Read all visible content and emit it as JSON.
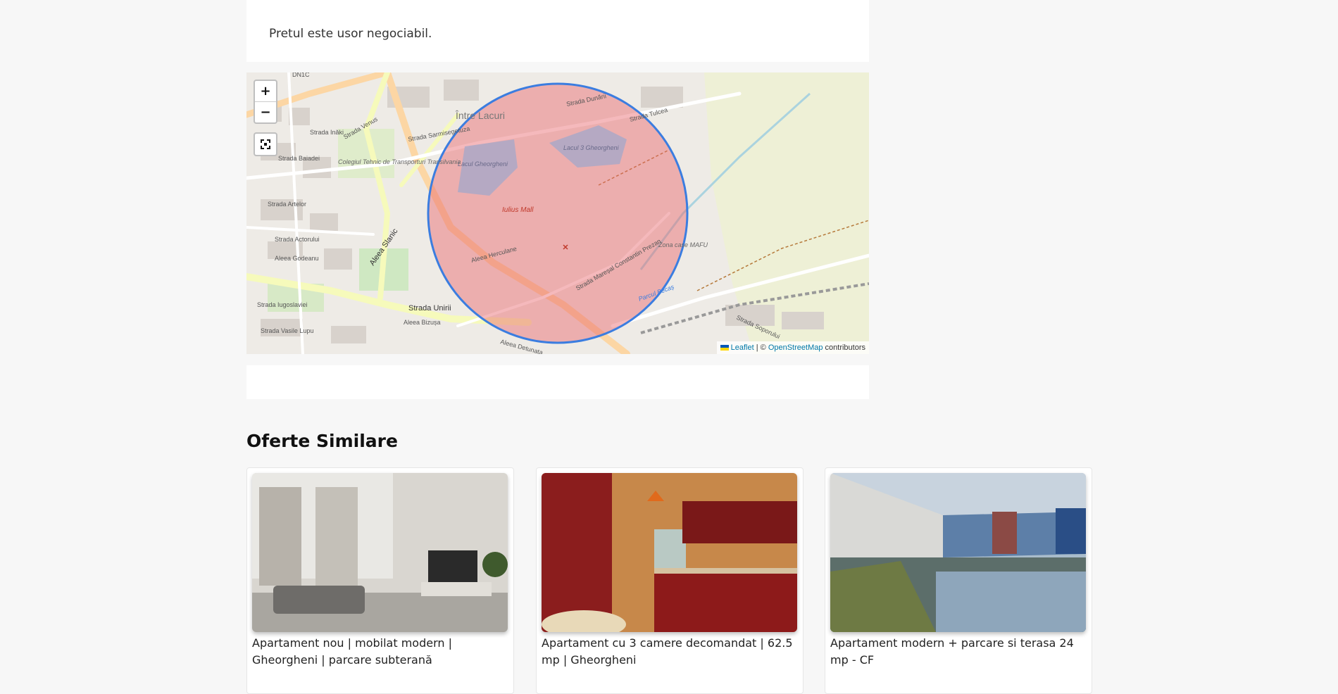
{
  "description": {
    "text": "Pretul este usor negociabil."
  },
  "map": {
    "zoom_in": "+",
    "zoom_out": "−",
    "fullscreen_icon": "fullscreen-icon",
    "attribution": {
      "leaflet": "Leaflet",
      "separator": " | © ",
      "osm": "OpenStreetMap",
      "suffix": " contributors"
    },
    "labels": {
      "intre_lacuri": "Între Lacuri",
      "strada_dunarii": "Strada Dunării",
      "strada_sarmisegetuza": "Strada Sarmisegetuza",
      "lacul_gheorgheni": "Lacul Gheorgheni",
      "lacul_3": "Lacul 3 Gheorgheni",
      "iulius": "Iulius Mall",
      "colegiul": "Colegiul Tehnic de Transporturi Transilvania",
      "aleea_slanic": "Aleea Slanic",
      "strada_unirii": "Strada Unirii",
      "aleea_herculane": "Aleea Herculane",
      "strada_prezan": "Strada Mareșal Constantin Prezan",
      "zona_mafu": "Zona case MAFU",
      "strada_soporului": "Strada Soporului",
      "strada_artelor": "Strada Artelor",
      "aleea_godeanu": "Aleea Godeanu",
      "strada_actorului": "Strada Actorului",
      "strada_baiadei": "Strada Baiadei",
      "strada_iugoslaviei": "Strada Iugoslaviei",
      "strada_vasile_lupu": "Strada Vasile Lupu",
      "aleea_bizusa": "Aleea Bizușa",
      "strada_tulcea": "Strada Tulcea",
      "parcul_becas": "Parcul Becaș",
      "aleea_detunata": "Aleea Detunata",
      "strada_inaki": "Strada Inăki",
      "strada_venus": "Strada Venus",
      "dn1c": "DN1C"
    },
    "circle_color": "#3b7de0",
    "circle_fill": "#e8636b"
  },
  "similar": {
    "title": "Oferte Similare",
    "listings": [
      {
        "title": "Apartament nou | mobilat modern | Gheorgheni | parcare subterană",
        "image": "living-room-photo"
      },
      {
        "title": "Apartament cu 3 camere decomandat | 62.5 mp | Gheorgheni",
        "image": "red-kitchen-photo"
      },
      {
        "title": "Apartament modern + parcare si terasa 24 mp - CF",
        "image": "building-lake-photo"
      }
    ]
  }
}
